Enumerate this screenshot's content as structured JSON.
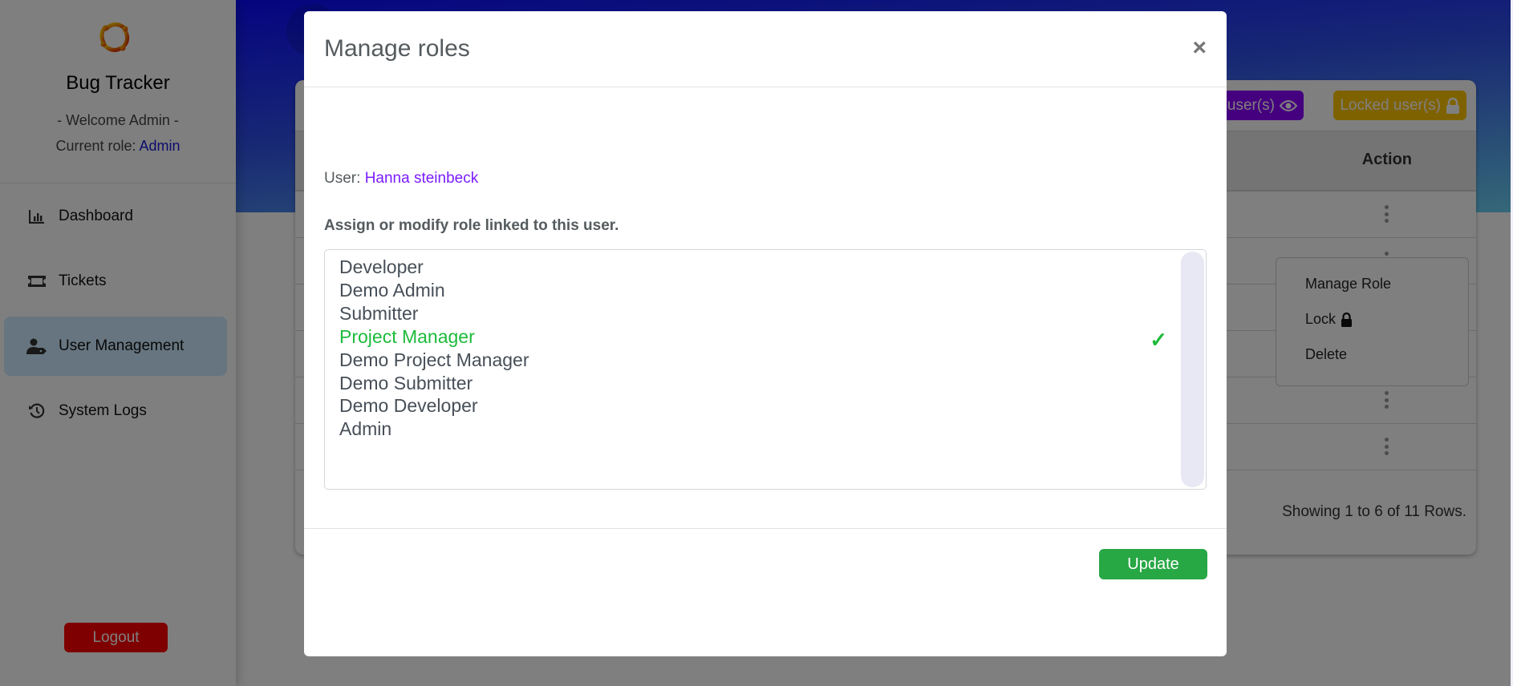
{
  "sidebar": {
    "brand": "Bug Tracker",
    "welcome": "- Welcome Admin -",
    "role_label": "Current role: ",
    "role_value": "Admin",
    "items": [
      {
        "label": "Dashboard",
        "icon": "chart-bar-icon",
        "active": false
      },
      {
        "label": "Tickets",
        "icon": "ticket-icon",
        "active": false
      },
      {
        "label": "User Management",
        "icon": "user-tag-icon",
        "active": true
      },
      {
        "label": "System Logs",
        "icon": "history-icon",
        "active": false
      }
    ],
    "logout_label": "Logout"
  },
  "users_card": {
    "pending_badge": "Pending user(s)",
    "locked_badge": "Locked user(s)",
    "action_header": "Action",
    "row_count": 6,
    "showing_text": "Showing 1 to 6 of 11 Rows.",
    "row_menu": {
      "items": [
        "Manage Role",
        "Lock",
        "Delete"
      ]
    }
  },
  "modal": {
    "title": "Manage roles",
    "close_label": "×",
    "user_label": "User: ",
    "user_name": "Hanna steinbeck",
    "instruction": "Assign or modify role linked to this user.",
    "roles": [
      {
        "label": "Developer",
        "selected": false
      },
      {
        "label": "Demo Admin",
        "selected": false
      },
      {
        "label": "Submitter",
        "selected": false
      },
      {
        "label": "Project Manager",
        "selected": true
      },
      {
        "label": "Demo Project Manager",
        "selected": false
      },
      {
        "label": "Demo Submitter",
        "selected": false
      },
      {
        "label": "Demo Developer",
        "selected": false
      },
      {
        "label": "Admin",
        "selected": false
      }
    ],
    "check_mark": "✓",
    "update_label": "Update"
  },
  "colors": {
    "selected_role": "#1dbb3b",
    "update_button": "#28a745",
    "logout_button": "#ff0000",
    "user_name": "#7a1cff",
    "pending_badge": "#8b00ff",
    "locked_badge": "#ffc400"
  }
}
